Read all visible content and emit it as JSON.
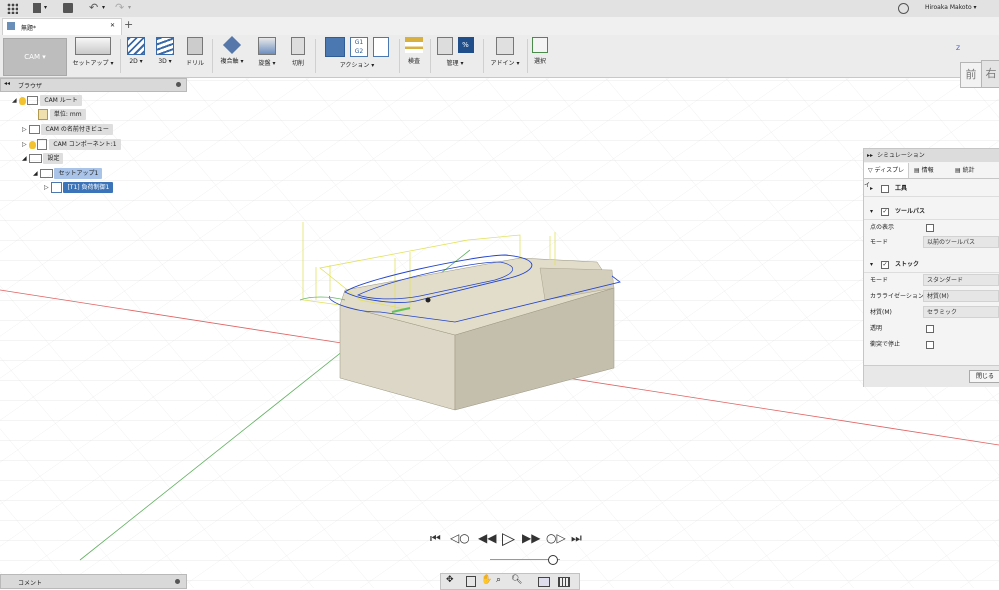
{
  "app": {
    "user_name": "Hiroaka Makoto",
    "doc_tab_title": "無題*"
  },
  "ribbon": {
    "workspace_label": "CAM",
    "items": [
      {
        "label": "セットアップ",
        "icon": "setup-icon"
      },
      {
        "label": "2D",
        "icon": "2d-icon"
      },
      {
        "label": "3D",
        "icon": "3d-icon"
      },
      {
        "label": "ドリル",
        "icon": "drill-icon"
      },
      {
        "label": "複合軸",
        "icon": "multiaxis-icon"
      },
      {
        "label": "旋盤",
        "icon": "turning-icon"
      },
      {
        "label": "切削",
        "icon": "cutting-icon"
      },
      {
        "label": "アクション",
        "icon": "actions-icon"
      },
      {
        "label": "検査",
        "icon": "inspect-icon"
      },
      {
        "label": "管理",
        "icon": "manage-icon"
      },
      {
        "label": "アドイン",
        "icon": "addins-icon"
      },
      {
        "label": "選択",
        "icon": "select-icon"
      }
    ]
  },
  "browser": {
    "title": "ブラウザ",
    "nodes": [
      {
        "label": "CAM ルート"
      },
      {
        "label": "単位: mm"
      },
      {
        "label": "CAM の名前付きビュー"
      },
      {
        "label": "CAM コンポーネント:1"
      },
      {
        "label": "設定"
      },
      {
        "label": "セットアップ1"
      },
      {
        "label": "[T1] 負荷制御1"
      }
    ]
  },
  "viewcube": {
    "front": "前",
    "right": "右",
    "axis": "Z"
  },
  "simulation": {
    "title": "シミュレーション",
    "tabs": [
      "ディスプレイ",
      "情報",
      "統計"
    ],
    "tool_section": "工具",
    "toolpath_section": "ツールパス",
    "show_points_label": "点の表示",
    "mode_label": "モード",
    "toolpath_mode_value": "以前のツールパス",
    "stock_section": "ストック",
    "stock_mode_value": "スタンダード",
    "colorization_label": "カラライゼーション",
    "colorization_value": "材質(M)",
    "material_label": "材質(M)",
    "material_value": "セラミック",
    "transparent_label": "透明",
    "stop_on_collision_label": "衝突で停止",
    "close_button": "閉じる"
  },
  "comment_label": "コメント"
}
